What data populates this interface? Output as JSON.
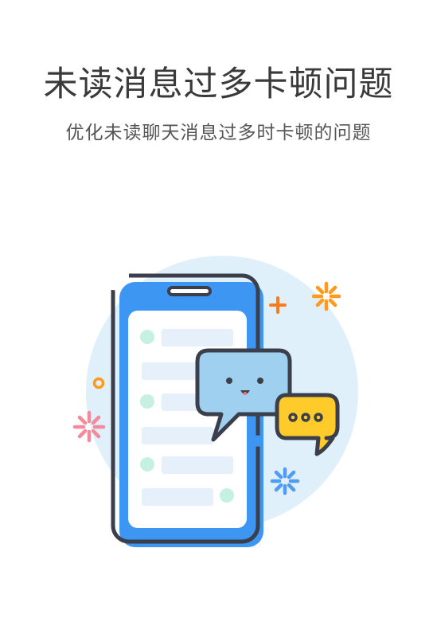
{
  "page": {
    "title": "未读消息过多卡顿问题",
    "subtitle": "优化未读聊天消息过多时卡顿的问题"
  },
  "illustration": {
    "icons": [
      "phone-icon",
      "chat-bubble-face-icon",
      "chat-bubble-ellipsis-icon",
      "plus-sparkle-icon",
      "flower-sparkle-icon",
      "ring-sparkle-icon"
    ],
    "colors": {
      "circle_bg": "#dff0fb",
      "phone_blue": "#3d96f2",
      "outline": "#3b3f4c",
      "bubble_blue": "#9fd0f0",
      "bubble_yellow": "#ffcb2b",
      "accent_orange": "#ff7a1a",
      "accent_pink": "#f58b9a",
      "accent_blue": "#4f9cf2",
      "accent_mint": "#c6f0e3"
    }
  }
}
